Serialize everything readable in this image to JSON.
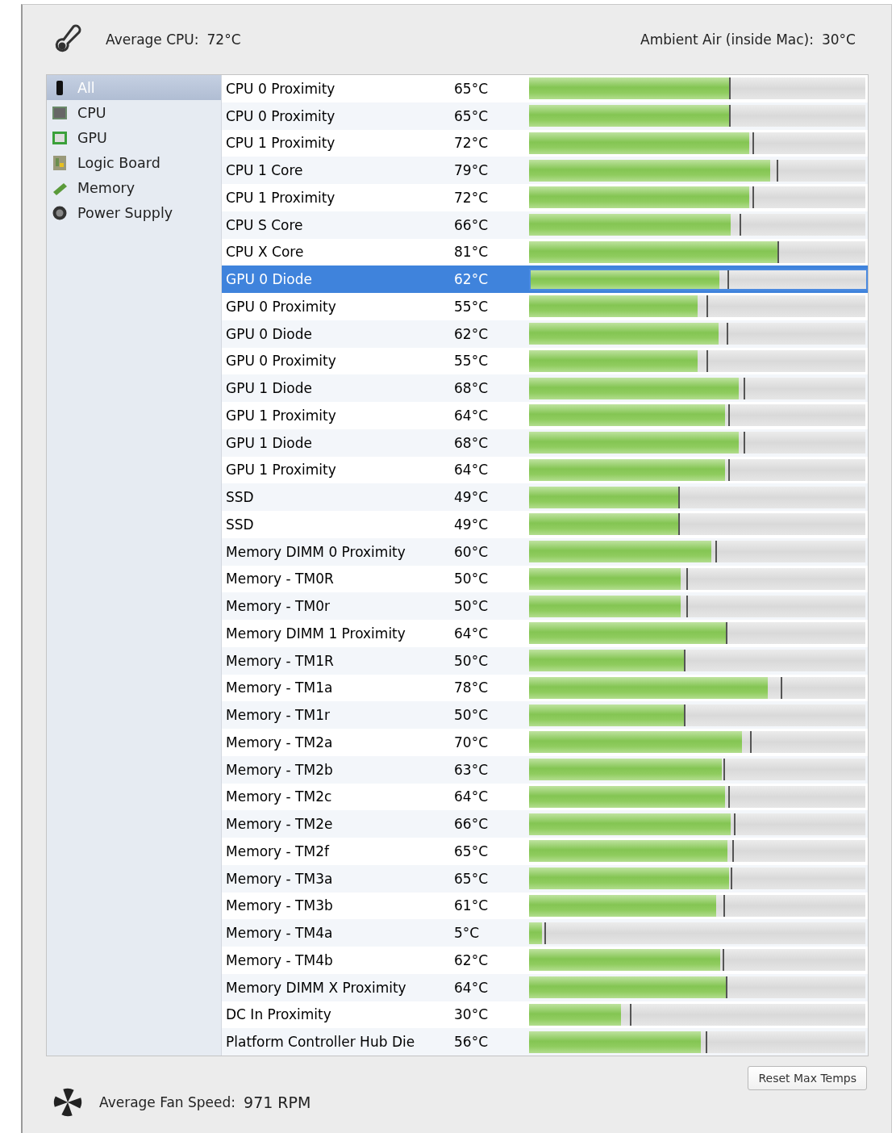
{
  "header": {
    "cpu_label": "Average CPU:",
    "cpu_value": "72°C",
    "ambient_label": "Ambient Air (inside Mac):",
    "ambient_value": "30°C"
  },
  "sidebar": {
    "items": [
      {
        "label": "All",
        "kind": "all",
        "selected": true
      },
      {
        "label": "CPU",
        "kind": "cpu",
        "selected": false
      },
      {
        "label": "GPU",
        "kind": "gpu",
        "selected": false
      },
      {
        "label": "Logic Board",
        "kind": "board",
        "selected": false
      },
      {
        "label": "Memory",
        "kind": "memory",
        "selected": false
      },
      {
        "label": "Power Supply",
        "kind": "power",
        "selected": false
      }
    ]
  },
  "sensors": [
    {
      "name": "CPU 0 Proximity",
      "reading": "65°C",
      "level": 0.597,
      "selected": false,
      "max_marker": {
        "level": 0.597
      }
    },
    {
      "name": "CPU 0 Proximity",
      "reading": "65°C",
      "level": 0.597,
      "selected": false,
      "max_marker": {
        "level": 0.597
      }
    },
    {
      "name": "CPU 1 Proximity",
      "reading": "72°C",
      "level": 0.655,
      "selected": false,
      "max_marker": {
        "level": 0.667
      }
    },
    {
      "name": "CPU 1 Core",
      "reading": "79°C",
      "level": 0.717,
      "selected": false,
      "max_marker": {
        "level": 0.739
      }
    },
    {
      "name": "CPU 1 Proximity",
      "reading": "72°C",
      "level": 0.655,
      "selected": false,
      "max_marker": {
        "level": 0.667
      }
    },
    {
      "name": "CPU S Core",
      "reading": "66°C",
      "level": 0.599,
      "selected": false,
      "max_marker": {
        "level": 0.628
      }
    },
    {
      "name": "CPU X Core",
      "reading": "81°C",
      "level": 0.742,
      "selected": false,
      "max_marker": {
        "level": 0.742
      }
    },
    {
      "name": "GPU 0 Diode",
      "reading": "62°C",
      "level": 0.563,
      "selected": true,
      "max_marker": {
        "level": 0.589
      }
    },
    {
      "name": "GPU 0 Proximity",
      "reading": "55°C",
      "level": 0.5,
      "selected": false,
      "max_marker": {
        "level": 0.531
      }
    },
    {
      "name": "GPU 0 Diode",
      "reading": "62°C",
      "level": 0.563,
      "selected": false,
      "max_marker": {
        "level": 0.589
      }
    },
    {
      "name": "GPU 0 Proximity",
      "reading": "55°C",
      "level": 0.5,
      "selected": false,
      "max_marker": {
        "level": 0.531
      }
    },
    {
      "name": "GPU 1 Diode",
      "reading": "68°C",
      "level": 0.623,
      "selected": false,
      "max_marker": {
        "level": 0.64
      }
    },
    {
      "name": "GPU 1 Proximity",
      "reading": "64°C",
      "level": 0.582,
      "selected": false,
      "max_marker": {
        "level": 0.594
      }
    },
    {
      "name": "GPU 1 Diode",
      "reading": "68°C",
      "level": 0.623,
      "selected": false,
      "max_marker": {
        "level": 0.64
      }
    },
    {
      "name": "GPU 1 Proximity",
      "reading": "64°C",
      "level": 0.582,
      "selected": false,
      "max_marker": {
        "level": 0.594
      }
    },
    {
      "name": "SSD",
      "reading": "49°C",
      "level": 0.447,
      "selected": false,
      "max_marker": {
        "level": 0.447
      }
    },
    {
      "name": "SSD",
      "reading": "49°C",
      "level": 0.447,
      "selected": false,
      "max_marker": {
        "level": 0.447
      }
    },
    {
      "name": "Memory DIMM 0 Proximity",
      "reading": "60°C",
      "level": 0.543,
      "selected": false,
      "max_marker": {
        "level": 0.556
      }
    },
    {
      "name": "Memory - TM0R",
      "reading": "50°C",
      "level": 0.452,
      "selected": false,
      "max_marker": {
        "level": 0.471
      }
    },
    {
      "name": "Memory - TM0r",
      "reading": "50°C",
      "level": 0.452,
      "selected": false,
      "max_marker": {
        "level": 0.471
      }
    },
    {
      "name": "Memory DIMM 1 Proximity",
      "reading": "64°C",
      "level": 0.587,
      "selected": false,
      "max_marker": {
        "level": 0.587
      }
    },
    {
      "name": "Memory - TM1R",
      "reading": "50°C",
      "level": 0.464,
      "selected": false,
      "max_marker": {
        "level": 0.464
      }
    },
    {
      "name": "Memory - TM1a",
      "reading": "78°C",
      "level": 0.71,
      "selected": false,
      "max_marker": {
        "level": 0.751
      }
    },
    {
      "name": "Memory - TM1r",
      "reading": "50°C",
      "level": 0.464,
      "selected": false,
      "max_marker": {
        "level": 0.464
      }
    },
    {
      "name": "Memory - TM2a",
      "reading": "70°C",
      "level": 0.633,
      "selected": false,
      "max_marker": {
        "level": 0.659
      }
    },
    {
      "name": "Memory - TM2b",
      "reading": "63°C",
      "level": 0.572,
      "selected": false,
      "max_marker": {
        "level": 0.58
      }
    },
    {
      "name": "Memory - TM2c",
      "reading": "64°C",
      "level": 0.582,
      "selected": false,
      "max_marker": {
        "level": 0.594
      }
    },
    {
      "name": "Memory - TM2e",
      "reading": "66°C",
      "level": 0.599,
      "selected": false,
      "max_marker": {
        "level": 0.611
      }
    },
    {
      "name": "Memory - TM2f",
      "reading": "65°C",
      "level": 0.589,
      "selected": false,
      "max_marker": {
        "level": 0.606
      }
    },
    {
      "name": "Memory - TM3a",
      "reading": "65°C",
      "level": 0.594,
      "selected": false,
      "max_marker": {
        "level": 0.601
      }
    },
    {
      "name": "Memory - TM3b",
      "reading": "61°C",
      "level": 0.556,
      "selected": false,
      "max_marker": {
        "level": 0.58
      }
    },
    {
      "name": "Memory - TM4a",
      "reading": "5°C",
      "level": 0.039,
      "selected": false,
      "max_marker": {
        "level": 0.048
      }
    },
    {
      "name": "Memory - TM4b",
      "reading": "62°C",
      "level": 0.568,
      "selected": false,
      "max_marker": {
        "level": 0.577
      }
    },
    {
      "name": "Memory DIMM X Proximity",
      "reading": "64°C",
      "level": 0.587,
      "selected": false,
      "max_marker": {
        "level": 0.587
      }
    },
    {
      "name": "DC In Proximity",
      "reading": "30°C",
      "level": 0.273,
      "selected": false,
      "max_marker": {
        "level": 0.302
      }
    },
    {
      "name": "Platform Controller Hub Die",
      "reading": "56°C",
      "level": 0.51,
      "selected": false,
      "max_marker": {
        "level": 0.527
      }
    }
  ],
  "footer": {
    "fan_label": "Average Fan Speed:",
    "fan_value": "971 RPM",
    "reset_button": "Reset Max Temps"
  }
}
